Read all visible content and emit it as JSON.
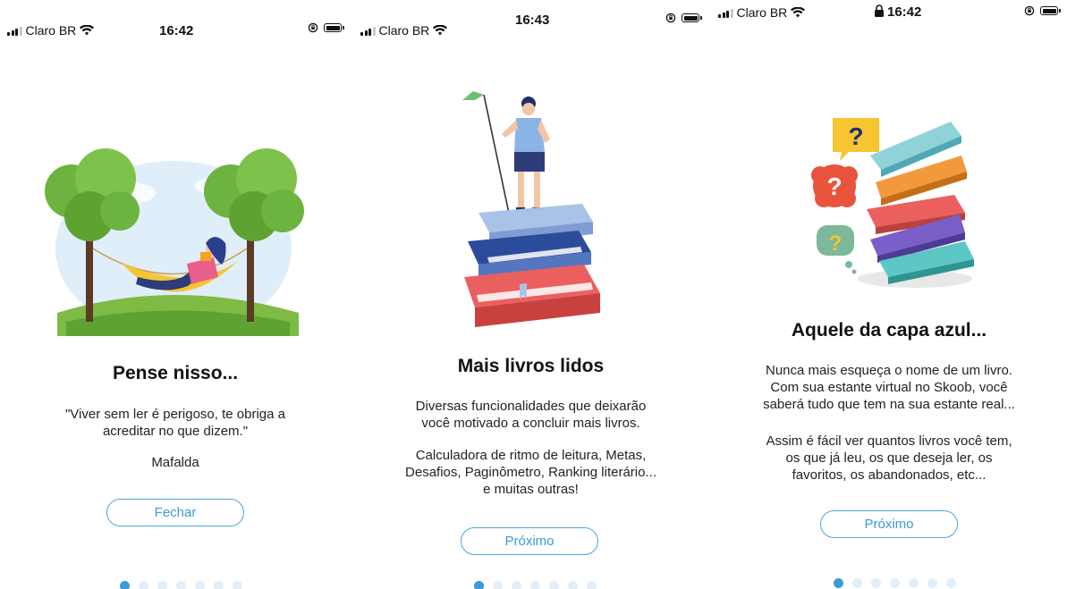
{
  "statusbar": {
    "carrier": "Claro BR",
    "screen1_time": "16:42",
    "screen2_time": "16:43",
    "screen3_time": "16:42"
  },
  "colors": {
    "accent": "#3a9bd8",
    "dot_inactive": "#e2eef8"
  },
  "screens": [
    {
      "title": "Pense nisso...",
      "body": [
        "\"Viver sem ler é perigoso, te obriga a",
        "acreditar no que dizem.\""
      ],
      "attribution": "Mafalda",
      "button_label": "Fechar",
      "page_dots": 7,
      "active_dot": 0
    },
    {
      "title": "Mais livros lidos",
      "paragraph1": [
        "Diversas funcionalidades que deixarão",
        "você motivado a concluir mais livros."
      ],
      "paragraph2": [
        "Calculadora de ritmo de leitura, Metas,",
        "Desafios, Paginômetro, Ranking literário...",
        "e muitas outras!"
      ],
      "button_label": "Próximo",
      "page_dots": 7,
      "active_dot": 0
    },
    {
      "title": "Aquele da capa azul...",
      "paragraph1": [
        "Nunca mais esqueça o nome de um livro.",
        "Com sua estante virtual no Skoob, você",
        "saberá tudo que tem na sua estante real..."
      ],
      "paragraph2": [
        "Assim é fácil ver quantos livros você tem,",
        "os que já leu, os que deseja ler, os",
        "favoritos, os abandonados, etc..."
      ],
      "button_label": "Próximo",
      "page_dots": 7,
      "active_dot": 0
    }
  ],
  "icons": {
    "signal": "signal-bars-icon",
    "wifi": "wifi-icon",
    "battery": "battery-icon",
    "rotation_lock": "rotation-lock-icon",
    "lock": "lock-icon"
  }
}
